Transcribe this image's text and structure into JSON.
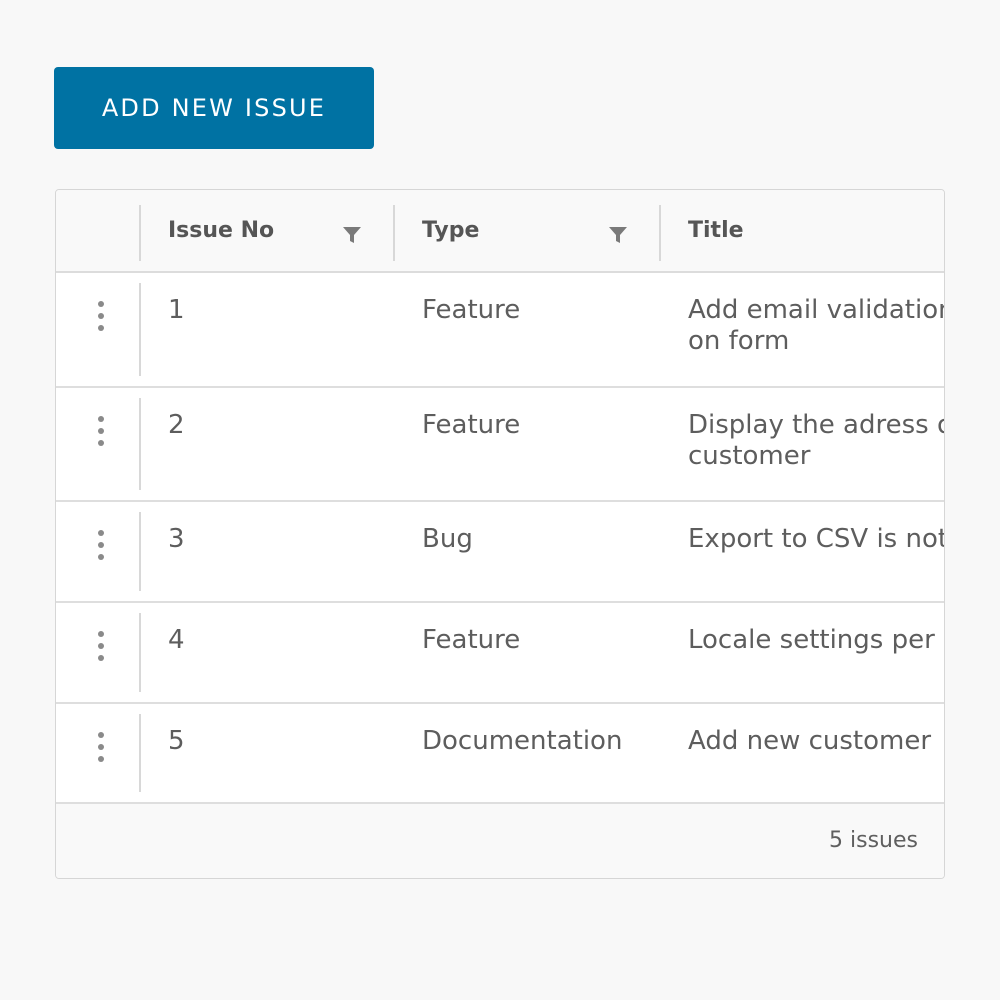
{
  "toolbar": {
    "add_button_label": "ADD NEW ISSUE"
  },
  "colors": {
    "primary_button": "#0072a3",
    "background": "#f8f8f8",
    "grid_border": "#d6d6d6"
  },
  "grid": {
    "columns": [
      {
        "label": "Issue No",
        "filterable": true,
        "filter_icon": "filter-icon"
      },
      {
        "label": "Type",
        "filterable": true,
        "filter_icon": "filter-icon"
      },
      {
        "label": "Title",
        "filterable": false
      }
    ],
    "row_action_icon": "kebab-menu-icon",
    "rows": [
      {
        "issue_no": "1",
        "type": "Feature",
        "title": "Add email validation on form"
      },
      {
        "issue_no": "2",
        "type": "Feature",
        "title": "Display the adress of customer"
      },
      {
        "issue_no": "3",
        "type": "Bug",
        "title": "Export to CSV is not working"
      },
      {
        "issue_no": "4",
        "type": "Feature",
        "title": "Locale settings per user"
      },
      {
        "issue_no": "5",
        "type": "Documentation",
        "title": "Add new customer"
      }
    ],
    "footer": {
      "count_label": "5 issues"
    }
  }
}
